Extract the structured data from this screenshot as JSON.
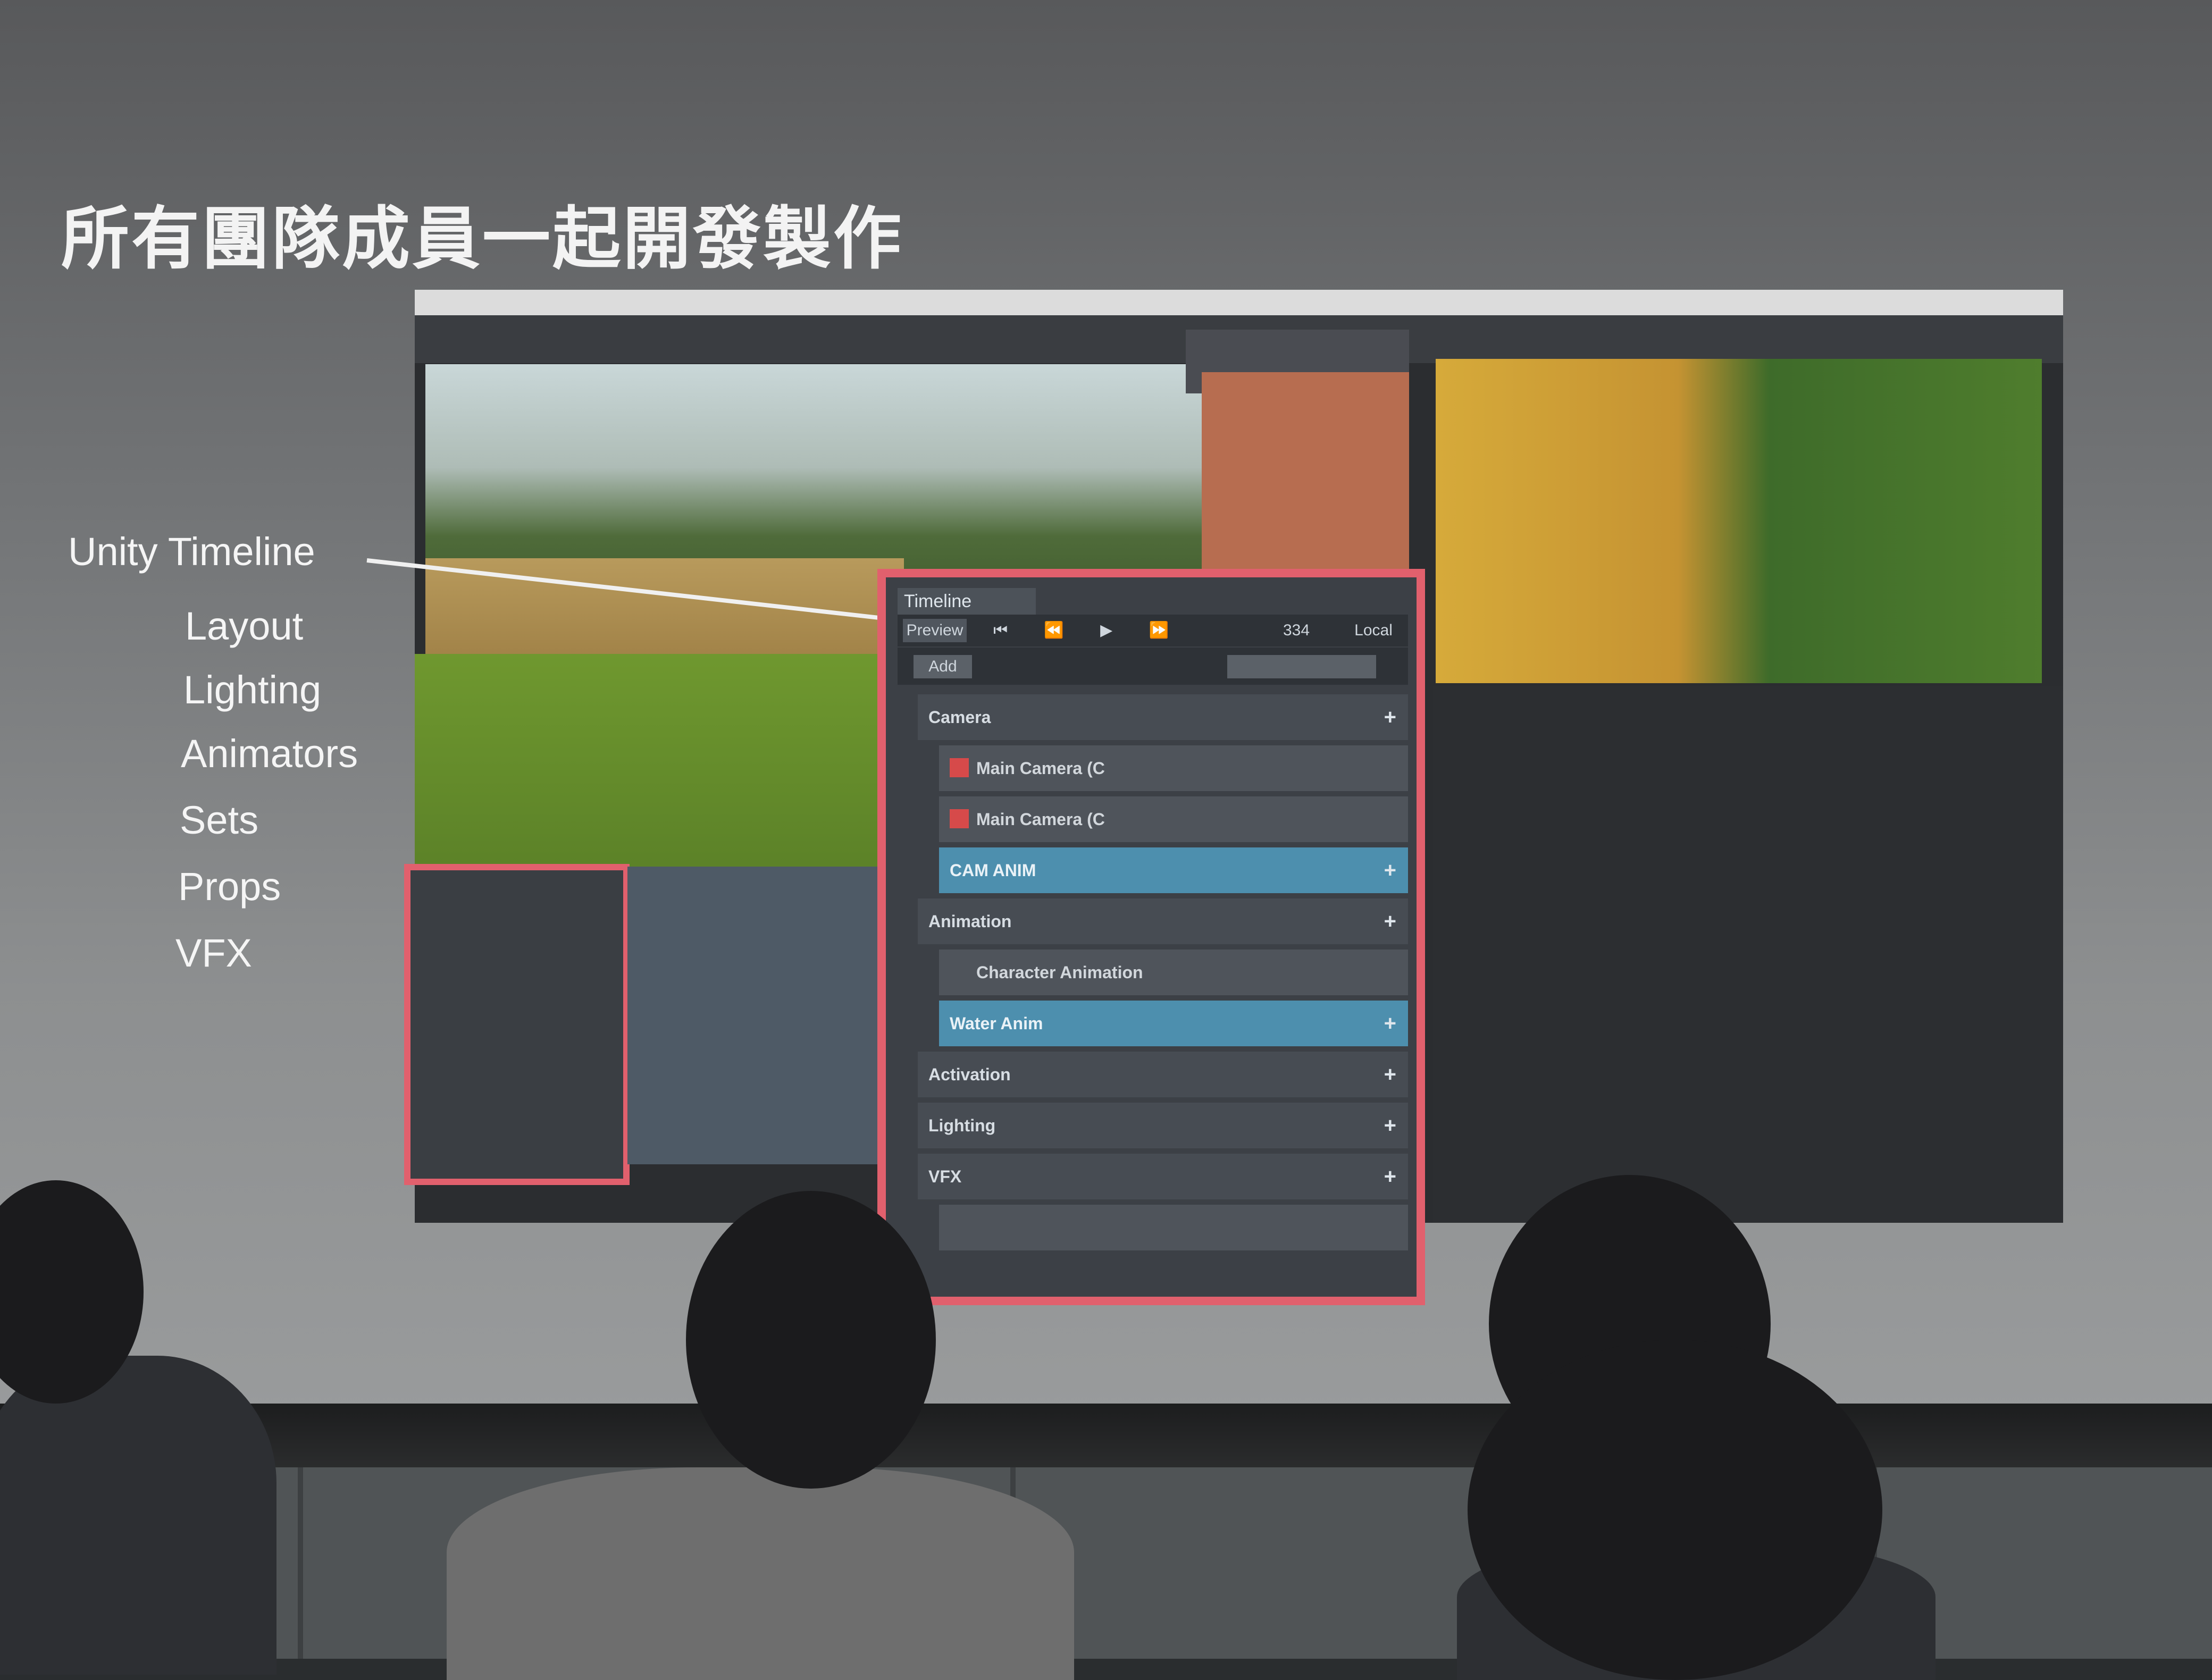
{
  "slide": {
    "title": "所有團隊成員一起開發製作",
    "items": [
      "Unity Timeline",
      "Layout",
      "Lighting",
      "Animators",
      "Sets",
      "Props",
      "VFX"
    ]
  },
  "timeline_panel": {
    "tab": "Timeline",
    "preview": "Preview",
    "frame": "334",
    "local": "Local",
    "add": "Add",
    "tracks": [
      {
        "label": "Camera",
        "kind": "group"
      },
      {
        "label": "Main Camera (C",
        "kind": "clip"
      },
      {
        "label": "Main Camera (C",
        "kind": "clip"
      },
      {
        "label": "CAM ANIM",
        "kind": "blue"
      },
      {
        "label": "Animation",
        "kind": "group"
      },
      {
        "label": "Character Animation",
        "kind": "clip"
      },
      {
        "label": "Water Anim",
        "kind": "blue"
      },
      {
        "label": "Activation",
        "kind": "group"
      },
      {
        "label": "Lighting",
        "kind": "group"
      },
      {
        "label": "VFX",
        "kind": "group"
      }
    ],
    "plus": "+"
  }
}
